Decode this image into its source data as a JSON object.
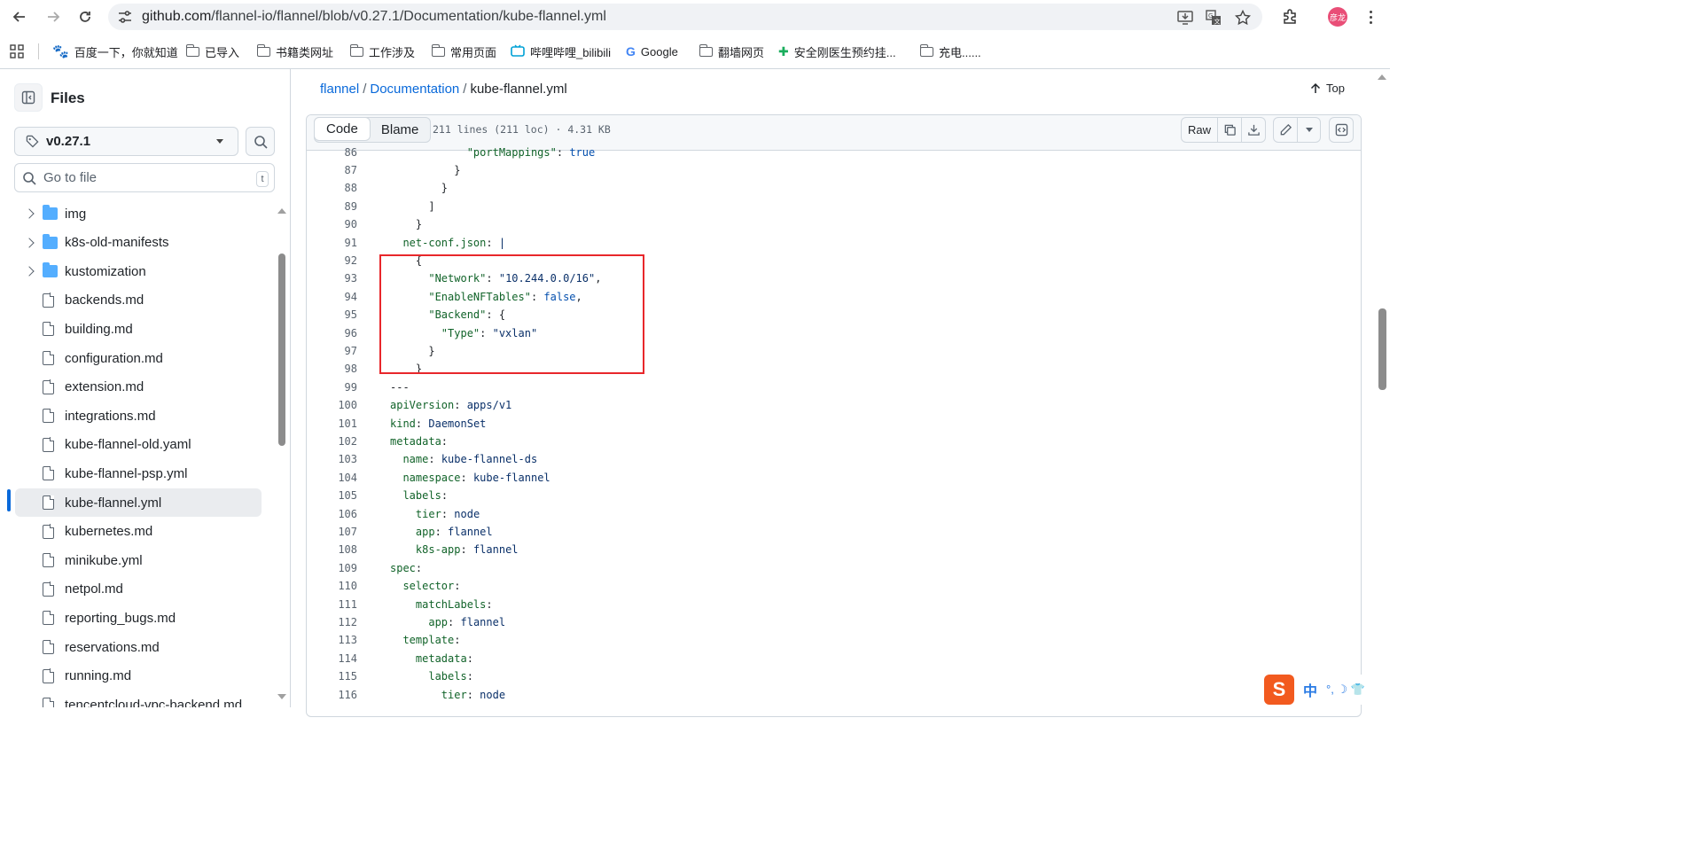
{
  "browser": {
    "url_host": "github.com",
    "url_path": "/flannel-io/flannel/blob/v0.27.1/Documentation/kube-flannel.yml",
    "profile_initials": "彦龙",
    "bookmarks": [
      "百度一下，你就知道",
      "已导入",
      "书籍类网址",
      "工作涉及",
      "常用页面",
      "哔哩哔哩_bilibili",
      "Google",
      "翻墙网页",
      "安全刚医生预约挂...",
      "充电......"
    ]
  },
  "sidebar": {
    "title": "Files",
    "branch": "v0.27.1",
    "goto_placeholder": "Go to file",
    "goto_kbd": "t",
    "items": [
      {
        "label": "img",
        "type": "folder"
      },
      {
        "label": "k8s-old-manifests",
        "type": "folder"
      },
      {
        "label": "kustomization",
        "type": "folder"
      },
      {
        "label": "backends.md",
        "type": "file"
      },
      {
        "label": "building.md",
        "type": "file"
      },
      {
        "label": "configuration.md",
        "type": "file"
      },
      {
        "label": "extension.md",
        "type": "file"
      },
      {
        "label": "integrations.md",
        "type": "file"
      },
      {
        "label": "kube-flannel-old.yaml",
        "type": "file"
      },
      {
        "label": "kube-flannel-psp.yml",
        "type": "file"
      },
      {
        "label": "kube-flannel.yml",
        "type": "file",
        "active": true
      },
      {
        "label": "kubernetes.md",
        "type": "file"
      },
      {
        "label": "minikube.yml",
        "type": "file"
      },
      {
        "label": "netpol.md",
        "type": "file"
      },
      {
        "label": "reporting_bugs.md",
        "type": "file"
      },
      {
        "label": "reservations.md",
        "type": "file"
      },
      {
        "label": "running.md",
        "type": "file"
      },
      {
        "label": "tencentcloud-vpc-backend.md",
        "type": "file"
      }
    ]
  },
  "breadcrumb": {
    "repo": "flannel",
    "dir": "Documentation",
    "file": "kube-flannel.yml",
    "top_label": "Top"
  },
  "file_header": {
    "tab_code": "Code",
    "tab_blame": "Blame",
    "meta": "211 lines (211 loc) · 4.31 KB",
    "raw_label": "Raw"
  },
  "code_lines": [
    {
      "n": "86",
      "t": "            \"portMappings\": true"
    },
    {
      "n": "87",
      "t": "          }"
    },
    {
      "n": "88",
      "t": "        }"
    },
    {
      "n": "89",
      "t": "      ]"
    },
    {
      "n": "90",
      "t": "    }"
    },
    {
      "n": "91",
      "t": "  net-conf.json: |"
    },
    {
      "n": "92",
      "t": "    {"
    },
    {
      "n": "93",
      "t": "      \"Network\": \"10.244.0.0/16\","
    },
    {
      "n": "94",
      "t": "      \"EnableNFTables\": false,"
    },
    {
      "n": "95",
      "t": "      \"Backend\": {"
    },
    {
      "n": "96",
      "t": "        \"Type\": \"vxlan\""
    },
    {
      "n": "97",
      "t": "      }"
    },
    {
      "n": "98",
      "t": "    }"
    },
    {
      "n": "99",
      "t": "---"
    },
    {
      "n": "100",
      "t": "apiVersion: apps/v1"
    },
    {
      "n": "101",
      "t": "kind: DaemonSet"
    },
    {
      "n": "102",
      "t": "metadata:"
    },
    {
      "n": "103",
      "t": "  name: kube-flannel-ds"
    },
    {
      "n": "104",
      "t": "  namespace: kube-flannel"
    },
    {
      "n": "105",
      "t": "  labels:"
    },
    {
      "n": "106",
      "t": "    tier: node"
    },
    {
      "n": "107",
      "t": "    app: flannel"
    },
    {
      "n": "108",
      "t": "    k8s-app: flannel"
    },
    {
      "n": "109",
      "t": "spec:"
    },
    {
      "n": "110",
      "t": "  selector:"
    },
    {
      "n": "111",
      "t": "    matchLabels:"
    },
    {
      "n": "112",
      "t": "      app: flannel"
    },
    {
      "n": "113",
      "t": "  template:"
    },
    {
      "n": "114",
      "t": "    metadata:"
    },
    {
      "n": "115",
      "t": "      labels:"
    },
    {
      "n": "116",
      "t": "        tier: node"
    }
  ],
  "ime": {
    "logo": "S",
    "mode": "中"
  },
  "colors": {
    "link": "#0969da",
    "highlight_box": "#e8272b",
    "yaml_key": "#116329",
    "yaml_string": "#0a3069"
  }
}
